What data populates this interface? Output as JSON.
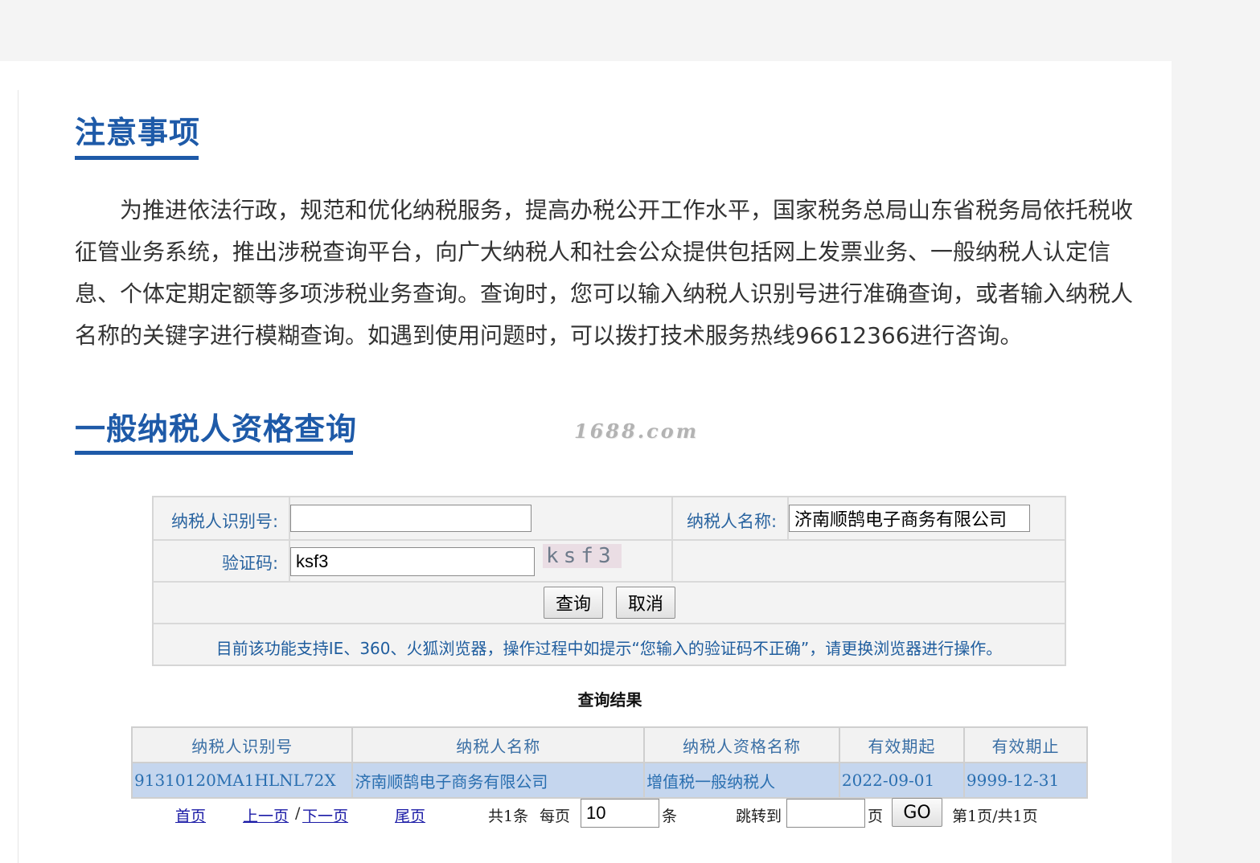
{
  "notice": {
    "title": "注意事项",
    "body": "为推进依法行政，规范和优化纳税服务，提高办税公开工作水平，国家税务总局山东省税务局依托税收征管业务系统，推出涉税查询平台，向广大纳税人和社会公众提供包括网上发票业务、一般纳税人认定信息、个体定期定额等多项涉税业务查询。查询时，您可以输入纳税人识别号进行准确查询，或者输入纳税人名称的关键字进行模糊查询。如遇到使用问题时，可以拨打技术服务热线96612366进行咨询。"
  },
  "query": {
    "title": "一般纳税人资格查询",
    "watermark": "1688.com",
    "taxpayer_id_label": "纳税人识别号:",
    "taxpayer_id_value": "",
    "taxpayer_name_label": "纳税人名称:",
    "taxpayer_name_value": "济南顺鹄电子商务有限公司",
    "captcha_label": "验证码:",
    "captcha_value": "ksf3",
    "captcha_image_text": "ksf3",
    "query_button": "查询",
    "cancel_button": "取消",
    "browser_note": "目前该功能支持IE、360、火狐浏览器，操作过程中如提示“您输入的验证码不正确”，请更换浏览器进行操作。"
  },
  "results": {
    "title": "查询结果",
    "headers": [
      "纳税人识别号",
      "纳税人名称",
      "纳税人资格名称",
      "有效期起",
      "有效期止"
    ],
    "rows": [
      [
        "91310120MA1HLNL72X",
        "济南顺鹄电子商务有限公司",
        "增值税一般纳税人",
        "2022-09-01",
        "9999-12-31"
      ]
    ]
  },
  "pager": {
    "first": "首页",
    "prev": "上一页",
    "separator": "/",
    "next": "下一页",
    "last": "尾页",
    "total": "共1条",
    "per_page_label": "每页",
    "per_page_value": "10",
    "per_page_unit": "条",
    "jump_label": "跳转到",
    "jump_value": "",
    "jump_unit": "页",
    "go_button": "GO",
    "page_info": "第1页/共1页"
  },
  "colors": {
    "heading": "#1e5aa8",
    "label": "#2a64a0",
    "row_highlight": "#c5d6ee",
    "link": "#1a1aa6"
  }
}
